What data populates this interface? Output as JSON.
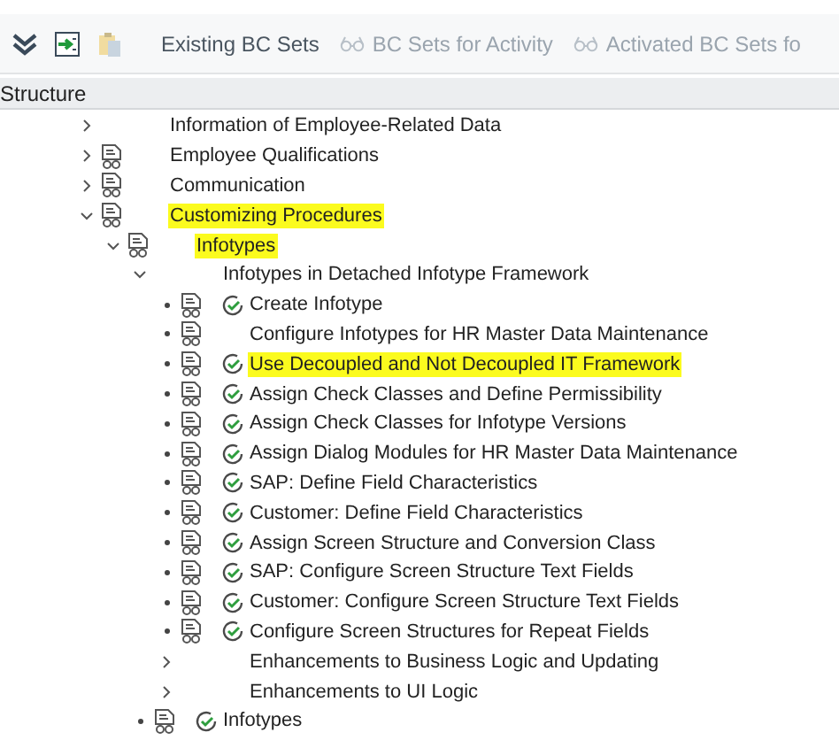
{
  "toolbar": {
    "icons": [
      {
        "kind": "collapse",
        "disabled": false
      },
      {
        "kind": "jump",
        "disabled": false
      },
      {
        "kind": "paste",
        "disabled": true
      }
    ],
    "buttons": [
      {
        "label": "Existing BC Sets",
        "icon": false,
        "disabled": false
      },
      {
        "label": "BC Sets for Activity",
        "icon": true,
        "disabled": true
      },
      {
        "label": "Activated BC Sets fo",
        "icon": true,
        "disabled": true
      }
    ]
  },
  "structure": {
    "title": "Structure",
    "nodes": [
      {
        "label": "Information of Employee-Related Data",
        "kind": "folder",
        "expanded": false,
        "documentation": false,
        "executable": false,
        "highlighted": false
      },
      {
        "label": "Employee Qualifications",
        "kind": "folder",
        "expanded": false,
        "documentation": true,
        "executable": false,
        "highlighted": false
      },
      {
        "label": "Communication",
        "kind": "folder",
        "expanded": false,
        "documentation": true,
        "executable": false,
        "highlighted": false
      },
      {
        "label": "Customizing Procedures",
        "kind": "folder",
        "expanded": true,
        "documentation": true,
        "executable": false,
        "highlighted": true,
        "children": [
          {
            "label": "Infotypes",
            "kind": "folder",
            "expanded": true,
            "documentation": true,
            "executable": false,
            "highlighted": true,
            "children": [
              {
                "label": "Infotypes in Detached Infotype Framework",
                "kind": "folder",
                "expanded": true,
                "documentation": false,
                "executable": false,
                "highlighted": false,
                "children": [
                  {
                    "label": "Create Infotype",
                    "kind": "activity",
                    "documentation": true,
                    "executable": true,
                    "highlighted": false
                  },
                  {
                    "label": "Configure Infotypes for HR Master Data Maintenance",
                    "kind": "activity",
                    "documentation": true,
                    "executable": false,
                    "highlighted": false
                  },
                  {
                    "label": "Use Decoupled and Not Decoupled IT Framework",
                    "kind": "activity",
                    "documentation": true,
                    "executable": true,
                    "highlighted": true
                  },
                  {
                    "label": "Assign Check Classes and Define Permissibility",
                    "kind": "activity",
                    "documentation": true,
                    "executable": true,
                    "highlighted": false
                  },
                  {
                    "label": "Assign Check Classes for Infotype Versions",
                    "kind": "activity",
                    "documentation": true,
                    "executable": true,
                    "highlighted": false
                  },
                  {
                    "label": "Assign Dialog Modules for HR Master Data Maintenance",
                    "kind": "activity",
                    "documentation": true,
                    "executable": true,
                    "highlighted": false
                  },
                  {
                    "label": "SAP: Define Field Characteristics",
                    "kind": "activity",
                    "documentation": true,
                    "executable": true,
                    "highlighted": false
                  },
                  {
                    "label": "Customer: Define Field Characteristics",
                    "kind": "activity",
                    "documentation": true,
                    "executable": true,
                    "highlighted": false
                  },
                  {
                    "label": "Assign Screen Structure and Conversion Class",
                    "kind": "activity",
                    "documentation": true,
                    "executable": true,
                    "highlighted": false
                  },
                  {
                    "label": "SAP: Configure Screen Structure Text Fields",
                    "kind": "activity",
                    "documentation": true,
                    "executable": true,
                    "highlighted": false
                  },
                  {
                    "label": "Customer: Configure Screen Structure Text Fields",
                    "kind": "activity",
                    "documentation": true,
                    "executable": true,
                    "highlighted": false
                  },
                  {
                    "label": "Configure Screen Structures for Repeat Fields",
                    "kind": "activity",
                    "documentation": true,
                    "executable": true,
                    "highlighted": false
                  },
                  {
                    "label": "Enhancements to Business Logic and Updating",
                    "kind": "folder",
                    "expanded": false,
                    "documentation": false,
                    "executable": false,
                    "highlighted": false
                  },
                  {
                    "label": "Enhancements to UI Logic",
                    "kind": "folder",
                    "expanded": false,
                    "documentation": false,
                    "executable": false,
                    "highlighted": false
                  }
                ]
              },
              {
                "label": "Infotypes",
                "kind": "activity",
                "documentation": true,
                "executable": true,
                "highlighted": false
              }
            ]
          }
        ]
      }
    ]
  }
}
